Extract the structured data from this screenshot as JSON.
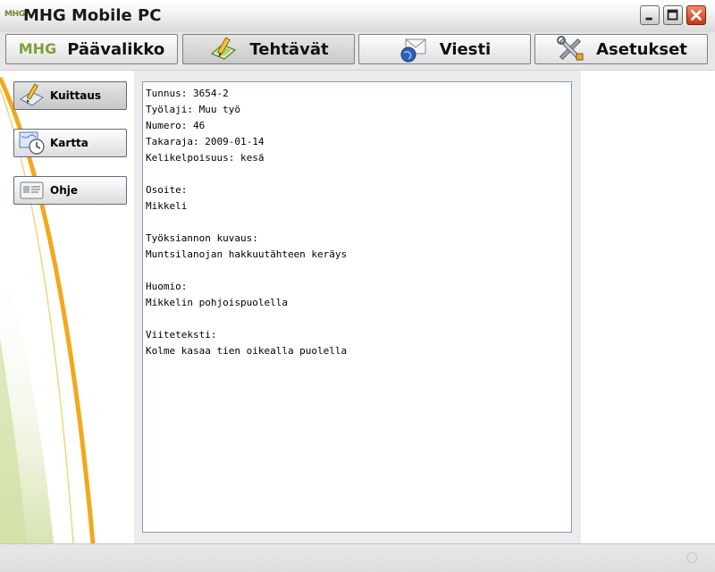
{
  "window": {
    "logo_text": "MHG",
    "title": "MHG Mobile PC"
  },
  "nav": {
    "tabs": [
      {
        "label": "Päävalikko",
        "icon": "mhg-logo-icon",
        "logo_text": "MHG",
        "active": false
      },
      {
        "label": "Tehtävät",
        "icon": "task-pencil-icon",
        "active": true
      },
      {
        "label": "Viesti",
        "icon": "message-globe-icon",
        "active": false
      },
      {
        "label": "Asetukset",
        "icon": "tools-wrench-icon",
        "active": false
      }
    ]
  },
  "sidebar": {
    "buttons": [
      {
        "label": "Kuittaus",
        "icon": "acknowledge-pencil-icon"
      },
      {
        "label": "Kartta",
        "icon": "map-clock-icon"
      },
      {
        "label": "Ohje",
        "icon": "help-card-icon"
      }
    ]
  },
  "task_details": {
    "lines": [
      "Tunnus: 3654-2",
      "Työlaji: Muu työ",
      "Numero: 46",
      "Takaraja: 2009-01-14",
      "Kelikelpoisuus: kesä",
      "",
      "Osoite:",
      "Mikkeli",
      "",
      "Työksiannon kuvaus:",
      "Muntsilanojan hakkuutähteen keräys",
      "",
      "Huomio:",
      "Mikkelin pohjoispuolella",
      "",
      "Viiteteksti:",
      "Kolme kasaa tien oikealla puolella"
    ]
  },
  "colors": {
    "accent_green": "#7ea03a",
    "deco_orange": "#f2a81d",
    "close_red": "#c4361a"
  }
}
